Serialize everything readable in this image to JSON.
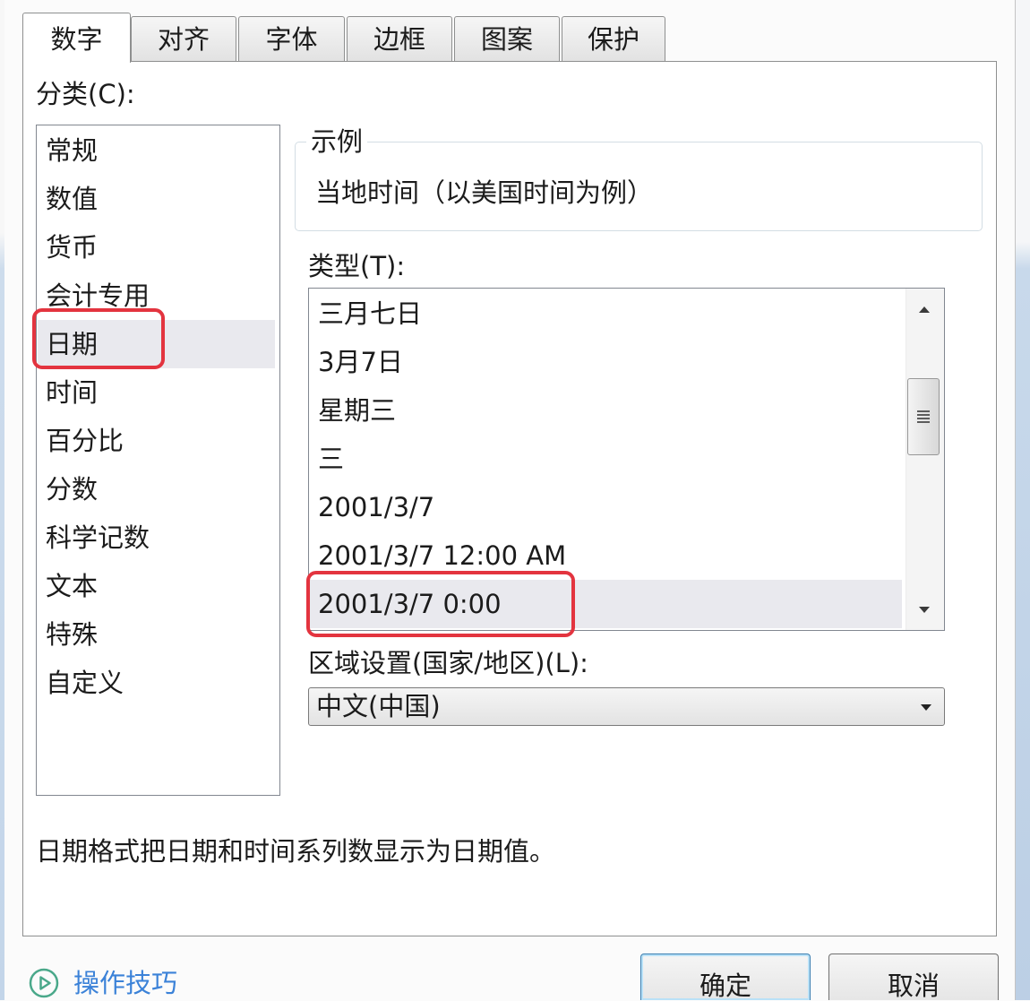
{
  "dialog": {
    "tabs": [
      {
        "label": "数字",
        "active": true
      },
      {
        "label": "对齐",
        "active": false
      },
      {
        "label": "字体",
        "active": false
      },
      {
        "label": "边框",
        "active": false
      },
      {
        "label": "图案",
        "active": false
      },
      {
        "label": "保护",
        "active": false
      }
    ],
    "category": {
      "label": "分类(C):",
      "items": [
        {
          "label": "常规"
        },
        {
          "label": "数值"
        },
        {
          "label": "货币"
        },
        {
          "label": "会计专用"
        },
        {
          "label": "日期",
          "selected": true,
          "highlighted": true
        },
        {
          "label": "时间"
        },
        {
          "label": "百分比"
        },
        {
          "label": "分数"
        },
        {
          "label": "科学记数"
        },
        {
          "label": "文本"
        },
        {
          "label": "特殊"
        },
        {
          "label": "自定义"
        }
      ]
    },
    "sample": {
      "legend": "示例",
      "text": "当地时间（以美国时间为例）"
    },
    "type": {
      "label": "类型(T):",
      "items": [
        {
          "label": "三月七日"
        },
        {
          "label": "3月7日"
        },
        {
          "label": "星期三"
        },
        {
          "label": "三"
        },
        {
          "label": "2001/3/7"
        },
        {
          "label": "2001/3/7 12:00 AM"
        },
        {
          "label": "2001/3/7 0:00",
          "selected": true,
          "highlighted": true
        }
      ],
      "scroll_position": 0.28
    },
    "locale": {
      "label": "区域设置(国家/地区)(L):",
      "value": "中文(中国)"
    },
    "description": "日期格式把日期和时间系列数显示为日期值。",
    "tips": {
      "label": "操作技巧",
      "icon": "play-circle-icon"
    },
    "buttons": {
      "ok": "确定",
      "cancel": "取消"
    }
  },
  "icons": {
    "scroll_up": "scroll-up-arrow-icon",
    "scroll_down": "scroll-down-arrow-icon",
    "scroll_grip": "grip-icon",
    "dropdown": "chevron-down-icon"
  },
  "colors": {
    "annotation_red": "#e3343f",
    "selection": "#e9e9ee",
    "link": "#3b82d8",
    "tips_icon": "#4aa88a",
    "default_button_border": "#3c7fb1"
  }
}
